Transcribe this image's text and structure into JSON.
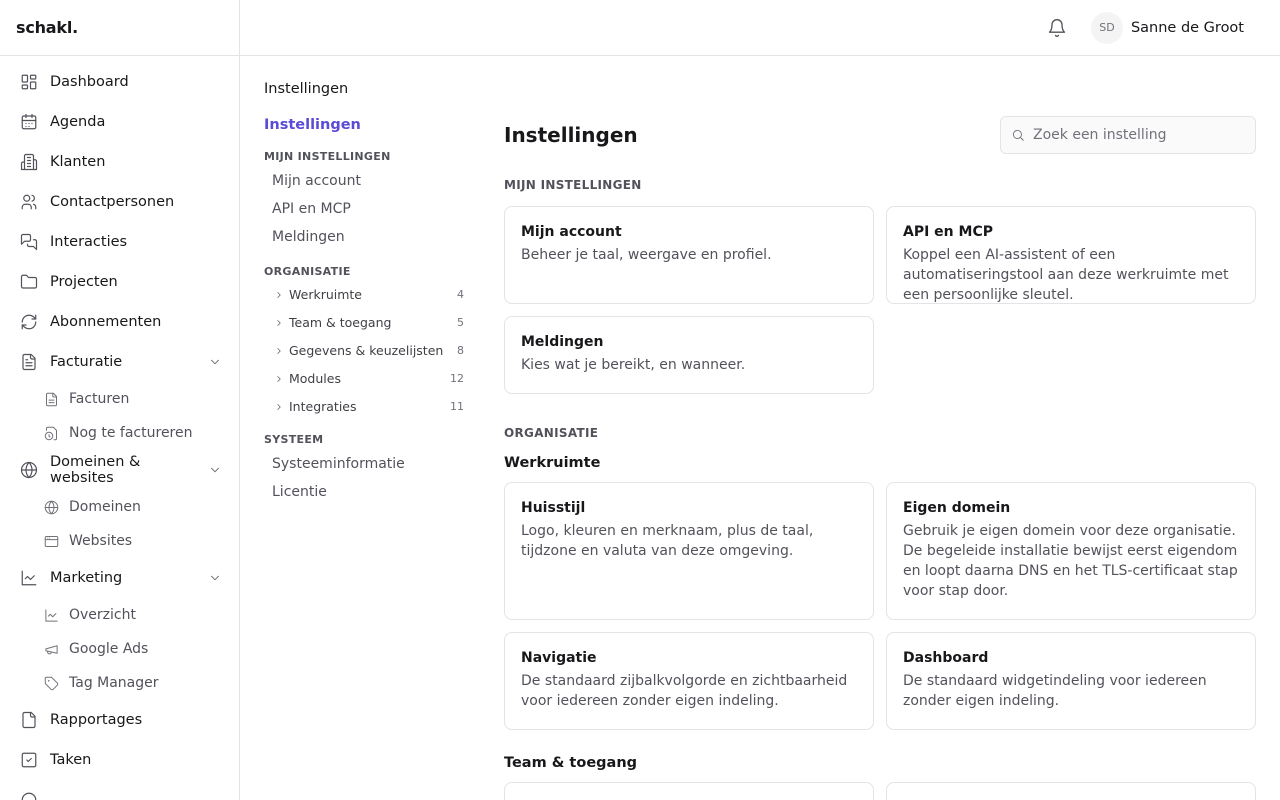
{
  "app": {
    "logo": "schakl."
  },
  "sidebar": {
    "items": [
      {
        "label": "Dashboard",
        "icon": "dashboard-icon"
      },
      {
        "label": "Agenda",
        "icon": "calendar-icon"
      },
      {
        "label": "Klanten",
        "icon": "building-icon"
      },
      {
        "label": "Contactpersonen",
        "icon": "users-icon"
      },
      {
        "label": "Interacties",
        "icon": "chat-icon"
      },
      {
        "label": "Projecten",
        "icon": "folder-icon"
      },
      {
        "label": "Abonnementen",
        "icon": "refresh-icon"
      }
    ],
    "facturatie": {
      "label": "Facturatie",
      "children": [
        {
          "label": "Facturen"
        },
        {
          "label": "Nog te factureren"
        }
      ]
    },
    "domeinen": {
      "label": "Domeinen & websites",
      "children": [
        {
          "label": "Domeinen"
        },
        {
          "label": "Websites"
        }
      ]
    },
    "marketing": {
      "label": "Marketing",
      "children": [
        {
          "label": "Overzicht"
        },
        {
          "label": "Google Ads"
        },
        {
          "label": "Tag Manager"
        }
      ]
    },
    "bottom": [
      {
        "label": "Rapportages"
      },
      {
        "label": "Taken"
      }
    ]
  },
  "topbar": {
    "initials": "SD",
    "user_name": "Sanne de Groot"
  },
  "subnav": {
    "heading": "Instellingen",
    "active": "Instellingen",
    "mijn_label": "MIJN INSTELLINGEN",
    "mijn_links": [
      "Mijn account",
      "API en MCP",
      "Meldingen"
    ],
    "org_label": "ORGANISATIE",
    "org_groups": [
      {
        "label": "Werkruimte",
        "count": "4"
      },
      {
        "label": "Team & toegang",
        "count": "5"
      },
      {
        "label": "Gegevens & keuzelijsten",
        "count": "8"
      },
      {
        "label": "Modules",
        "count": "12"
      },
      {
        "label": "Integraties",
        "count": "11"
      }
    ],
    "sys_label": "SYSTEEM",
    "sys_links": [
      "Systeeminformatie",
      "Licentie"
    ]
  },
  "main": {
    "title": "Instellingen",
    "search_placeholder": "Zoek een instelling",
    "mijn_label": "MIJN INSTELLINGEN",
    "mijn_cards": [
      {
        "title": "Mijn account",
        "desc": "Beheer je taal, weergave en profiel."
      },
      {
        "title": "API en MCP",
        "desc": "Koppel een AI-assistent of een automatiseringstool aan deze werkruimte met een persoonlijke sleutel."
      },
      {
        "title": "Meldingen",
        "desc": "Kies wat je bereikt, en wanneer."
      }
    ],
    "org_label": "ORGANISATIE",
    "werkruimte_label": "Werkruimte",
    "werkruimte_cards": [
      {
        "title": "Huisstijl",
        "desc": "Logo, kleuren en merknaam, plus de taal, tijdzone en valuta van deze omgeving."
      },
      {
        "title": "Eigen domein",
        "desc": "Gebruik je eigen domein voor deze organisatie. De begeleide installatie bewijst eerst eigendom en loopt daarna DNS en het TLS-certificaat stap voor stap door."
      },
      {
        "title": "Navigatie",
        "desc": "De standaard zijbalkvolgorde en zichtbaarheid voor iedereen zonder eigen indeling."
      },
      {
        "title": "Dashboard",
        "desc": "De standaard widgetindeling voor iedereen zonder eigen indeling."
      }
    ],
    "team_label": "Team & toegang"
  },
  "colors": {
    "accent": "#5b4bd6",
    "border": "#e4e4e7"
  }
}
